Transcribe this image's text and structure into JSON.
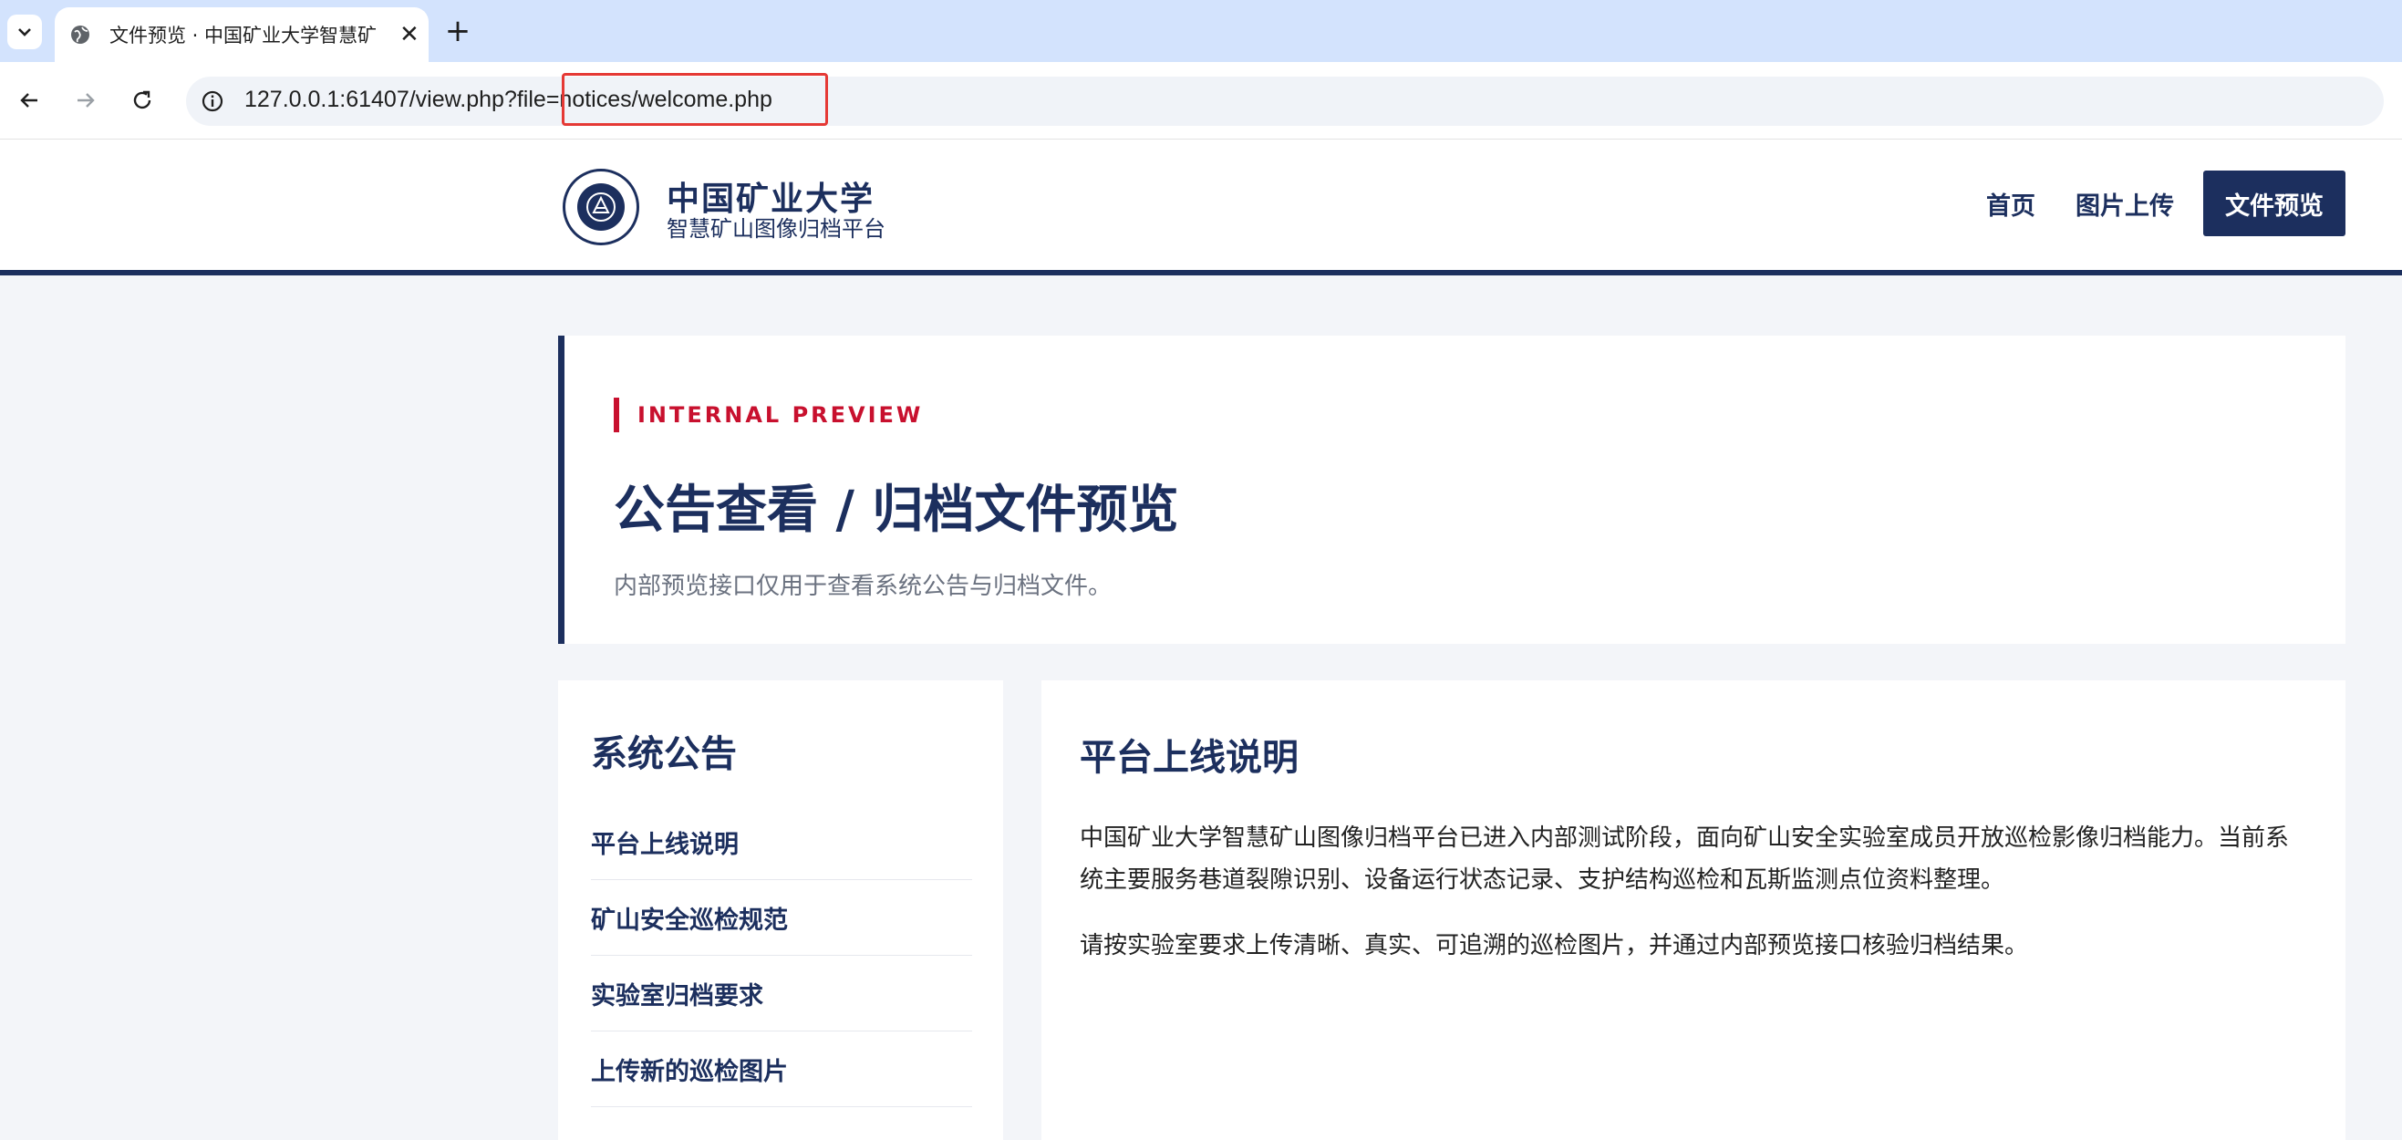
{
  "browser": {
    "tab_title": "文件预览 · 中国矿业大学智慧矿",
    "new_tab": "+",
    "close": "✕",
    "url": "127.0.0.1:61407/view.php?file=notices/welcome.php"
  },
  "header": {
    "brand_name": "中国矿业大学",
    "brand_subtitle": "智慧矿山图像归档平台",
    "nav": [
      {
        "label": "首页"
      },
      {
        "label": "图片上传"
      },
      {
        "label": "文件预览",
        "active": true
      }
    ]
  },
  "hero": {
    "eyebrow": "INTERNAL PREVIEW",
    "title": "公告查看 / 归档文件预览",
    "description": "内部预览接口仅用于查看系统公告与归档文件。"
  },
  "sidebar": {
    "title": "系统公告",
    "items": [
      {
        "label": "平台上线说明"
      },
      {
        "label": "矿山安全巡检规范"
      },
      {
        "label": "实验室归档要求"
      },
      {
        "label": "上传新的巡检图片"
      }
    ]
  },
  "content": {
    "title": "平台上线说明",
    "paragraphs": [
      "中国矿业大学智慧矿山图像归档平台已进入内部测试阶段，面向矿山安全实验室成员开放巡检影像归档能力。当前系统主要服务巷道裂隙识别、设备运行状态记录、支护结构巡检和瓦斯监测点位资料整理。",
      "请按实验室要求上传清晰、真实、可追溯的巡检图片，并通过内部预览接口核验归档结果。"
    ]
  },
  "colors": {
    "primary": "#1c2f5e",
    "accent": "#c8102e",
    "highlight_box": "#e53935"
  }
}
